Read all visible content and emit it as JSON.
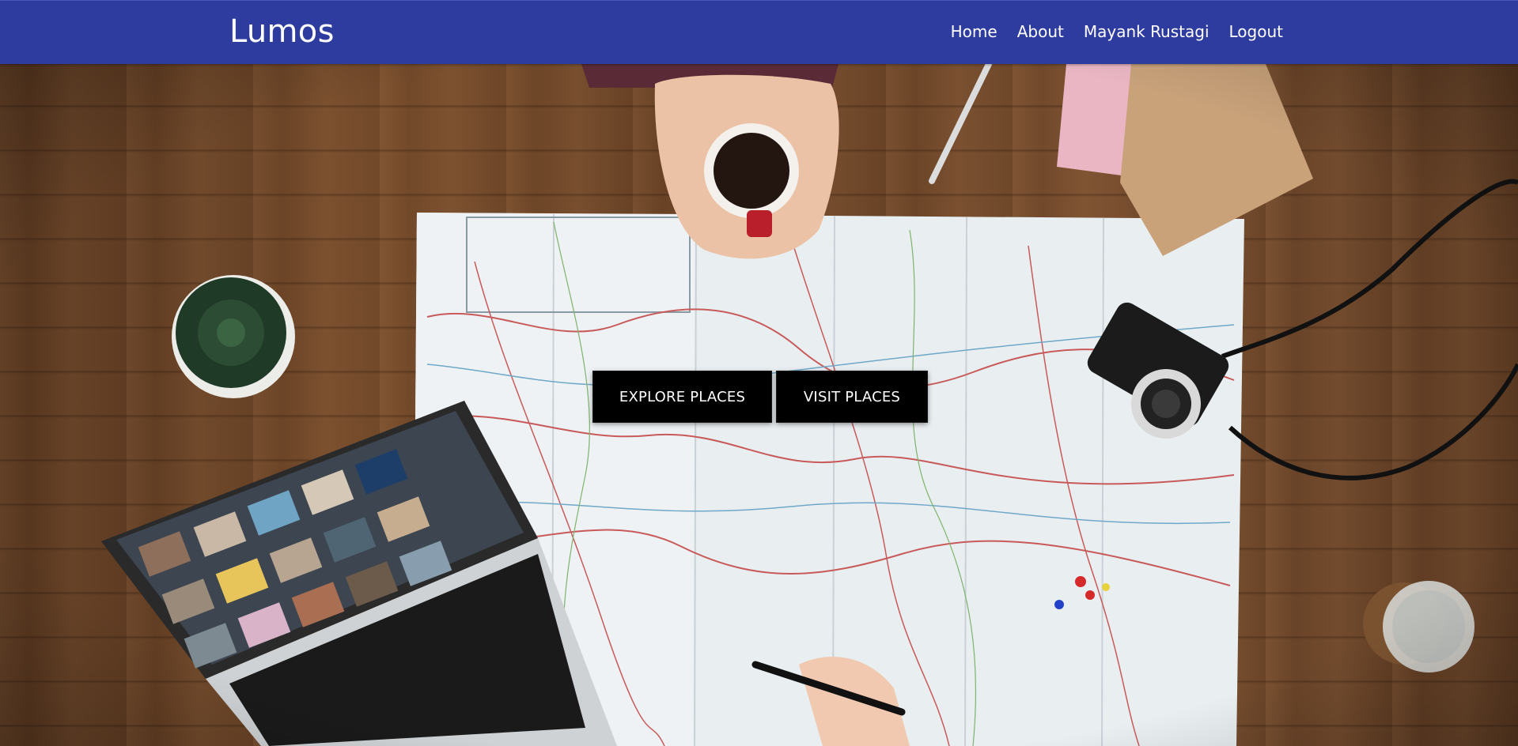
{
  "brand": {
    "name": "Lumos"
  },
  "nav": {
    "items": [
      {
        "label": "Home"
      },
      {
        "label": "About"
      },
      {
        "label": "Mayank Rustagi"
      },
      {
        "label": "Logout"
      }
    ]
  },
  "hero": {
    "buttons": [
      {
        "label": "EXPLORE PLACES"
      },
      {
        "label": "VISIT PLACES"
      }
    ]
  },
  "colors": {
    "navbar": "#2e3c9f",
    "button_bg": "#000000",
    "button_text": "#ffffff"
  }
}
